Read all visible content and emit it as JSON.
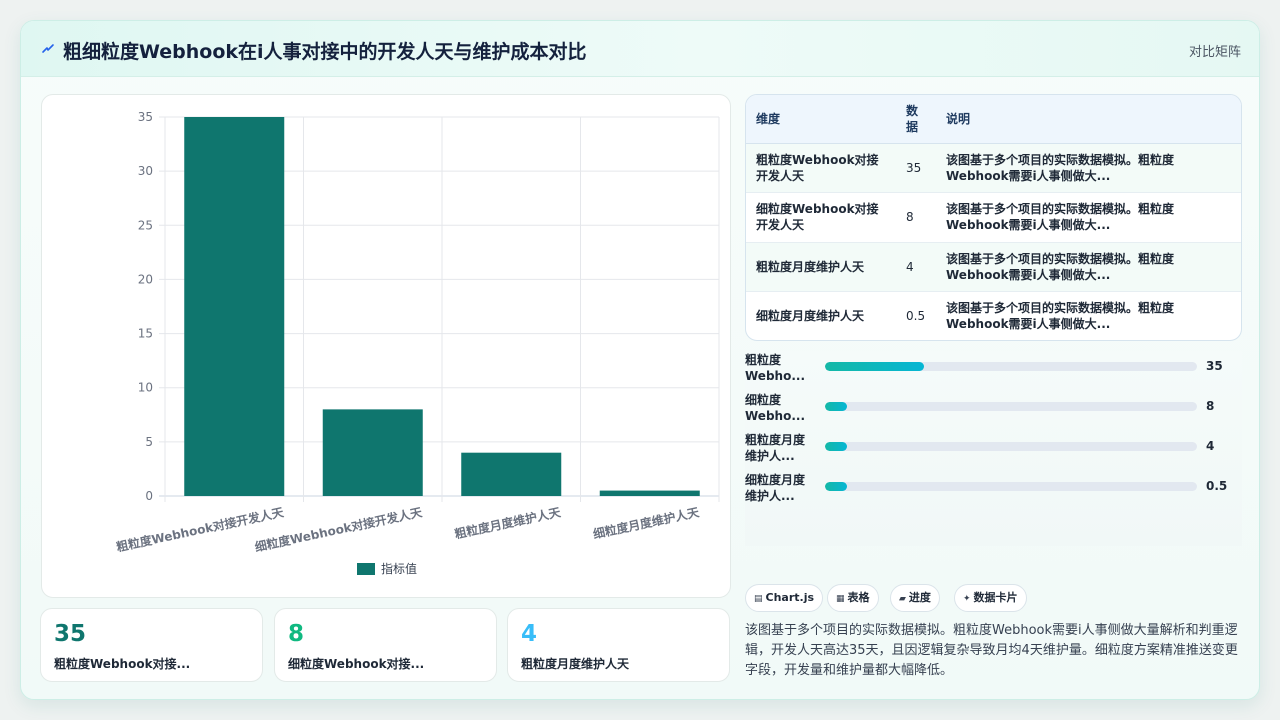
{
  "header": {
    "icon": "lightning-icon",
    "title": "粗细粒度Webhook在i人事对接中的开发人天与维护成本对比",
    "matrix_link": "对比矩阵"
  },
  "chart_data": {
    "type": "bar",
    "categories": [
      "粗粒度Webhook对接开发人天",
      "细粒度Webhook对接开发人天",
      "粗粒度月度维护人天",
      "细粒度月度维护人天"
    ],
    "series": [
      {
        "name": "指标值",
        "values": [
          35,
          8,
          4,
          0.5
        ]
      }
    ],
    "ylim": [
      0,
      35
    ],
    "yticks": [
      0,
      5,
      10,
      15,
      20,
      25,
      30,
      35
    ],
    "grid": true,
    "legend_position": "bottom",
    "bar_color": "#0f766e"
  },
  "table": {
    "headers": [
      "维度",
      "数据",
      "说明"
    ],
    "rows": [
      {
        "dimension": "粗粒度Webhook对接开发人天",
        "value": "35",
        "desc": "该图基于多个项目的实际数据模拟。粗粒度Webhook需要i人事侧做大..."
      },
      {
        "dimension": "细粒度Webhook对接开发人天",
        "value": "8",
        "desc": "该图基于多个项目的实际数据模拟。粗粒度Webhook需要i人事侧做大..."
      },
      {
        "dimension": "粗粒度月度维护人天",
        "value": "4",
        "desc": "该图基于多个项目的实际数据模拟。粗粒度Webhook需要i人事侧做大..."
      },
      {
        "dimension": "细粒度月度维护人天",
        "value": "0.5",
        "desc": "该图基于多个项目的实际数据模拟。粗粒度Webhook需要i人事侧做大..."
      }
    ]
  },
  "progress": [
    {
      "label": "粗粒度Webho...",
      "value": "35",
      "fraction": 0.265
    },
    {
      "label": "细粒度Webho...",
      "value": "8",
      "fraction": 0.06
    },
    {
      "label": "粗粒度月度维护人...",
      "value": "4",
      "fraction": 0.06
    },
    {
      "label": "细粒度月度维护人...",
      "value": "0.5",
      "fraction": 0.06
    }
  ],
  "chips": [
    {
      "icon": "chart-icon",
      "glyph": "▤",
      "label": "Chart.js"
    },
    {
      "icon": "table-icon",
      "glyph": "▦",
      "label": "表格"
    },
    {
      "icon": "progress-icon",
      "glyph": "▰",
      "label": "进度"
    },
    {
      "icon": "sparkle-icon",
      "glyph": "✦",
      "label": "数据卡片"
    }
  ],
  "summary": "该图基于多个项目的实际数据模拟。粗粒度Webhook需要i人事侧做大量解析和判重逻辑，开发人天高达35天，且因逻辑复杂导致月均4天维护量。细粒度方案精准推送变更字段，开发量和维护量都大幅降低。",
  "stats": [
    {
      "value": "35",
      "label": "粗粒度Webhook对接...",
      "color": "#0f766e"
    },
    {
      "value": "8",
      "label": "细粒度Webhook对接...",
      "color": "#10b981"
    },
    {
      "value": "4",
      "label": "粗粒度月度维护人天",
      "color": "#38bdf8"
    }
  ]
}
